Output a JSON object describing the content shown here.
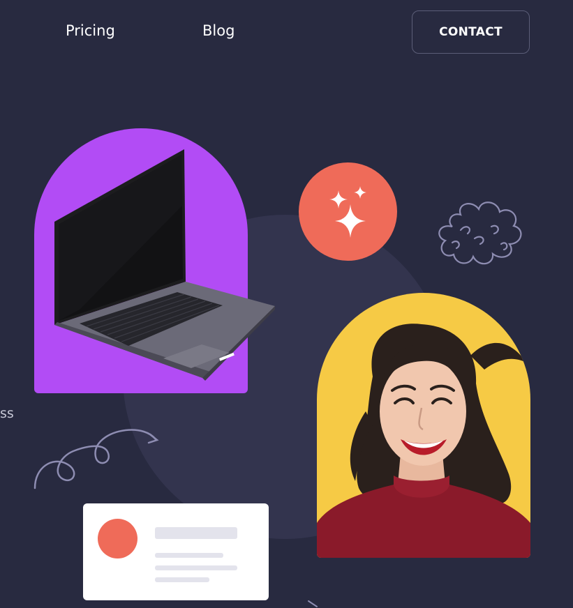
{
  "nav": {
    "links": [
      {
        "label": "Pricing"
      },
      {
        "label": "Blog"
      }
    ],
    "contact_label": "CONTACT"
  },
  "side_text": "ss",
  "colors": {
    "background": "#282a40",
    "accent_purple": "#b24cf5",
    "accent_yellow": "#f6ca45",
    "accent_coral": "#ef6b59",
    "doodle": "#8e8db2"
  },
  "icons": {
    "sparkle": "sparkles-icon",
    "cloud": "cloud-doodle",
    "swirl": "swirl-doodle"
  }
}
